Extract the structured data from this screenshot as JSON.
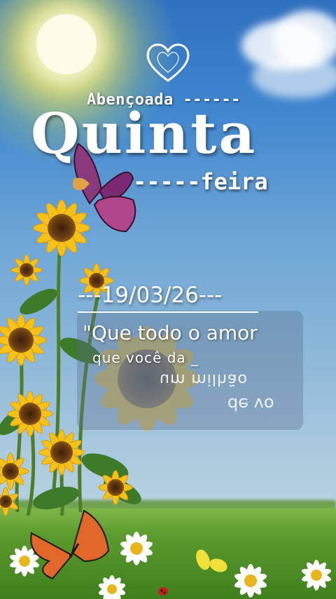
{
  "greeting": {
    "line1": "Abençoada ------",
    "line2": "Quinta",
    "line3": "-----feira"
  },
  "date": "---19/03/26---",
  "quote": {
    "line1": "\"Que todo o amor",
    "line2": "que você da _",
    "line3": "um milhão",
    "line4": "de vo"
  },
  "colors": {
    "text": "#ffffff",
    "sky_top": "#2f6fc0",
    "grass": "#5b9a2c",
    "sunflower_petal": "#f6c21a",
    "sunflower_center": "#6b3d12"
  },
  "icons": [
    "heart-outline-icon",
    "purple-butterfly",
    "monarch-butterfly",
    "yellow-butterfly",
    "ladybug"
  ]
}
